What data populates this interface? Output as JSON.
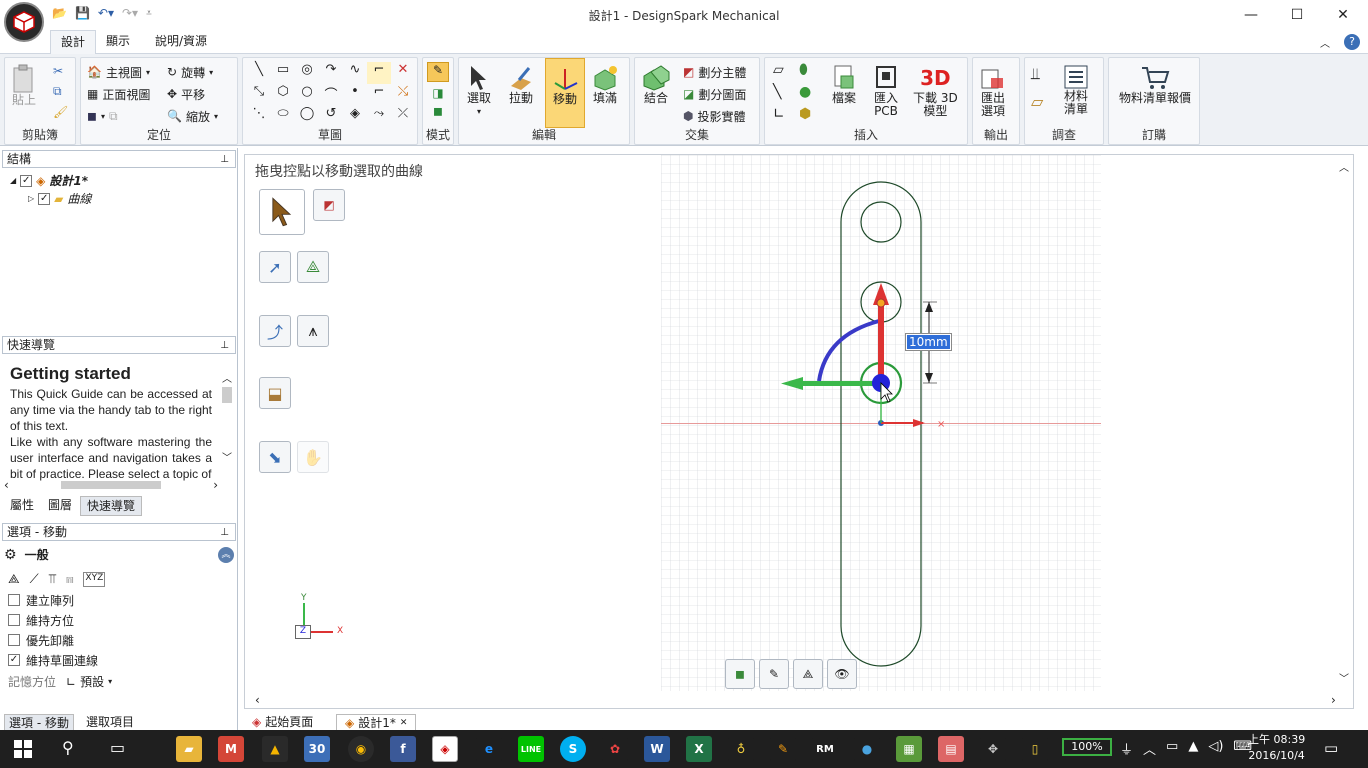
{
  "window": {
    "title": "設計1 - DesignSpark Mechanical",
    "minimize": "—",
    "maximize": "☐",
    "close": "✕"
  },
  "ribbon_tabs": [
    "設計",
    "顯示",
    "說明/資源"
  ],
  "ribbon": {
    "clipboard": {
      "paste": "貼上",
      "label": "剪貼簿"
    },
    "orient": {
      "home_view": "主視圖",
      "front_view": "正面視圖",
      "rotate": "旋轉",
      "pan": "平移",
      "zoom": "縮放",
      "label": "定位"
    },
    "sketch": {
      "label": "草圖"
    },
    "mode": {
      "label": "模式"
    },
    "edit": {
      "select": "選取",
      "pull": "拉動",
      "move": "移動",
      "fill": "填滿",
      "label": "編輯"
    },
    "intersect": {
      "combine": "結合",
      "split_body": "劃分主體",
      "split_face": "劃分圖面",
      "project": "投影實體",
      "label": "交集"
    },
    "insert": {
      "file": "檔案",
      "import_pcb": "匯入\nPCB",
      "download_3d": "下載 3D\n模型",
      "label": "插入"
    },
    "output": {
      "export": "匯出\n選項",
      "label": "輸出"
    },
    "investigate": {
      "bom": "材料\n清單",
      "label": "調查"
    },
    "order": {
      "bom_quote": "物料清單報價",
      "label": "訂購"
    }
  },
  "structure": {
    "header": "結構",
    "root": "設計1*",
    "child": "曲線"
  },
  "quick_guide": {
    "header": "快速導覽",
    "heading": "Getting started",
    "para1": "This Quick Guide can be accessed at any time via the handy tab to the right of this text.",
    "para2": "Like with any software mastering the user interface and navigation takes a bit of practice. Please select a topic of",
    "tabs": [
      "屬性",
      "圖層",
      "快速導覽"
    ]
  },
  "options": {
    "header": "選項 - 移動",
    "section": "一般",
    "checks": [
      {
        "label": "建立陣列",
        "checked": false
      },
      {
        "label": "維持方位",
        "checked": false
      },
      {
        "label": "優先卸離",
        "checked": false
      },
      {
        "label": "維持草圖連線",
        "checked": true
      }
    ],
    "memory_label": "記憶方位",
    "memory_value": "預設",
    "bottom_tabs": [
      "選項 - 移動",
      "選取項目"
    ]
  },
  "canvas": {
    "hint": "拖曳控點以移動選取的曲線",
    "dimension": "10mm",
    "axis_x": "X",
    "axis_y": "Y",
    "axis_z": "Z"
  },
  "doc_tabs": [
    "起始頁面",
    "設計1*"
  ],
  "taskbar": {
    "battery": "100%",
    "time": "上午 08:39",
    "date": "2016/10/4",
    "calendar_day": "30"
  }
}
